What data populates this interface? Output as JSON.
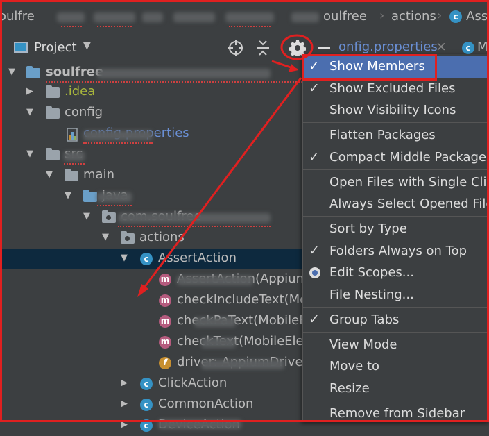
{
  "breadcrumb": {
    "project_partial": "oulfre",
    "module_partial": "oulfree",
    "current": "actions",
    "next_class_partial": "Asse",
    "class_icon_letter": "c"
  },
  "toolbar": {
    "title": "Project",
    "tab_partial": "onfig.properties",
    "tab_close": "×",
    "tab2_partial": "M"
  },
  "tree": {
    "rows": [
      {
        "label": "soulfree",
        "suffix": "\\...\\soulfree"
      },
      {
        "label": ".idea"
      },
      {
        "label": "config"
      },
      {
        "label": "config.properties"
      },
      {
        "label": "src"
      },
      {
        "label": "main"
      },
      {
        "label": "java"
      },
      {
        "label": "com.soulfree"
      },
      {
        "label": "actions"
      },
      {
        "label": "AssertAction"
      },
      {
        "label": "AssertAction(Appium"
      },
      {
        "label": "checkIncludeText(Mo"
      },
      {
        "label": "checkPaText(MobileE"
      },
      {
        "label": "checkText(MobileElen"
      },
      {
        "label": "driver: AppiumDriver<"
      },
      {
        "label": "ClickAction"
      },
      {
        "label": "CommonAction"
      },
      {
        "label": "DeviceAction"
      }
    ]
  },
  "menu": {
    "items": [
      {
        "label": "Show Members",
        "checked": true
      },
      {
        "label": "Show Excluded Files",
        "checked": true
      },
      {
        "label": "Show Visibility Icons",
        "checked": false
      },
      {
        "label": "Flatten Packages",
        "checked": false
      },
      {
        "label": "Compact Middle Packages",
        "checked": true
      },
      {
        "label": "Open Files with Single Click",
        "checked": false
      },
      {
        "label": "Always Select Opened File",
        "checked": false
      },
      {
        "label": "Sort by Type",
        "checked": false
      },
      {
        "label": "Folders Always on Top",
        "checked": true
      },
      {
        "label": "Edit Scopes...",
        "radio": true
      },
      {
        "label": "File Nesting...",
        "checked": false
      },
      {
        "label": "Group Tabs",
        "checked": true
      },
      {
        "label": "View Mode",
        "checked": false
      },
      {
        "label": "Move to",
        "checked": false
      },
      {
        "label": "Resize",
        "checked": false
      },
      {
        "label": "Remove from Sidebar",
        "checked": false
      }
    ],
    "check_glyph": "✓"
  },
  "colors": {
    "background": "#3c3f41",
    "selection": "#0d293e",
    "menu_highlight": "#4b6eaf",
    "annotation_red": "#e02020"
  }
}
